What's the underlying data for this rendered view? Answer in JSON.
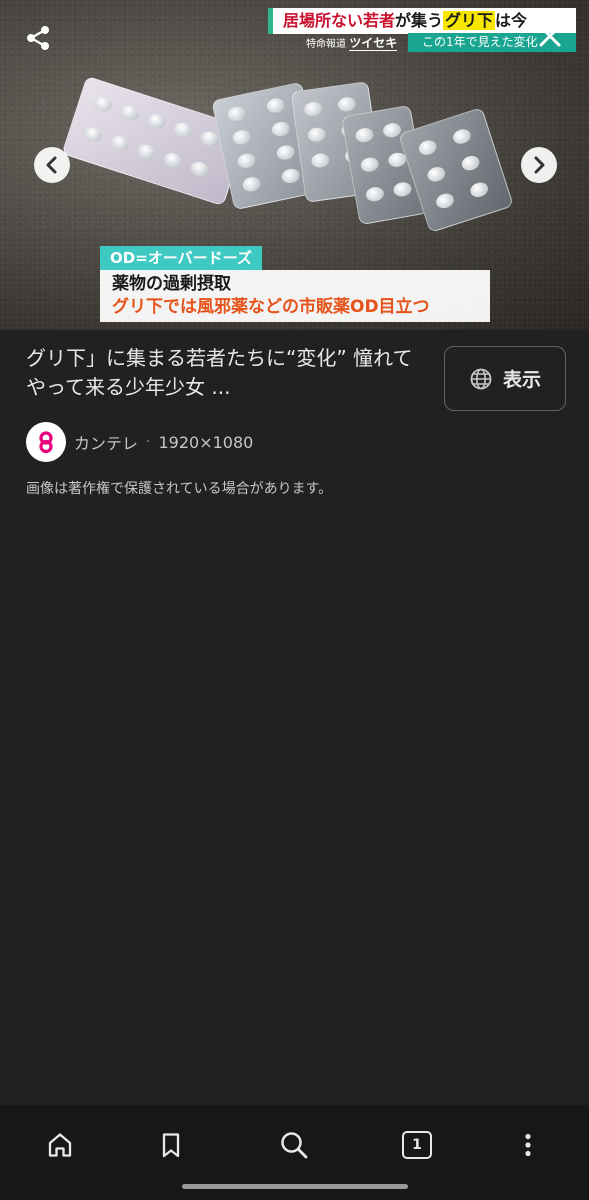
{
  "image": {
    "telop_top": {
      "part1": "居場所ない若者",
      "part2": "が集う",
      "part3": "グリ下",
      "part4": "は今"
    },
    "telop_program": "ツイセキ",
    "telop_program_prefix": "特命報道",
    "telop_sub": "この1年で見えた変化",
    "caption_tag": "OD=オーバードーズ",
    "caption_line1": "薬物の過剰摂取",
    "caption_line2": "グリ下では風邪薬などの市販薬OD目立つ"
  },
  "info": {
    "title": "グリ下」に集まる若者たちに“変化” 憧れてやって来る少年少女 ...",
    "visit_label": "表示",
    "source_name": "カンテレ",
    "separator": "·",
    "dimensions": "1920×1080",
    "notice": "画像は著作権で保護されている場合があります。"
  },
  "nav": {
    "tab_count": "1"
  },
  "colors": {
    "background": "#212121",
    "nav_background": "#171717",
    "favicon_accent": "#e6007e"
  }
}
